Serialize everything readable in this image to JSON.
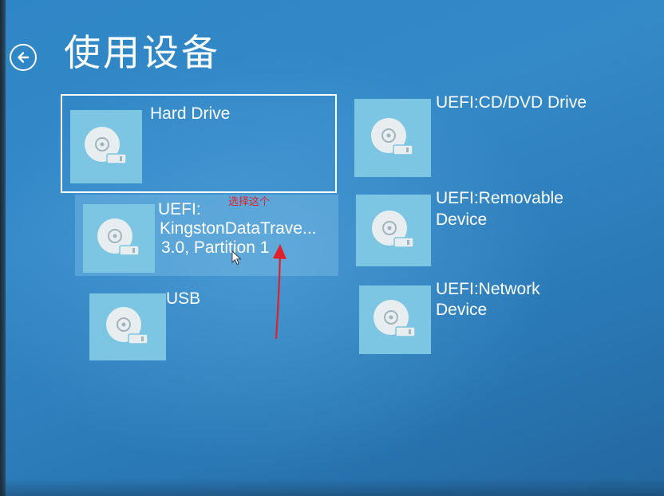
{
  "header": {
    "title": "使用设备",
    "back_icon": "back-arrow-circle-icon"
  },
  "devices": [
    {
      "label": "Hard Drive",
      "icon": "disk-drive-icon",
      "state": "selected"
    },
    {
      "label_lines": [
        "UEFI:",
        "KingstonDataTrave...",
        "3.0, Partition 1"
      ],
      "icon": "disk-drive-icon",
      "state": "highlighted"
    },
    {
      "label": "USB",
      "icon": "disk-drive-icon",
      "state": "normal"
    },
    {
      "label": "UEFI:CD/DVD Drive",
      "icon": "disk-drive-icon",
      "state": "normal"
    },
    {
      "label_lines": [
        "UEFI:Removable",
        "Device"
      ],
      "icon": "disk-drive-icon",
      "state": "normal"
    },
    {
      "label_lines": [
        "UEFI:Network",
        "Device"
      ],
      "icon": "disk-drive-icon",
      "state": "normal"
    }
  ],
  "annotation": {
    "text": "选择这个",
    "color": "#e0202a"
  },
  "colors": {
    "background": "#2f7fbd",
    "tile": "#7cc5e3",
    "text": "#ffffff"
  }
}
